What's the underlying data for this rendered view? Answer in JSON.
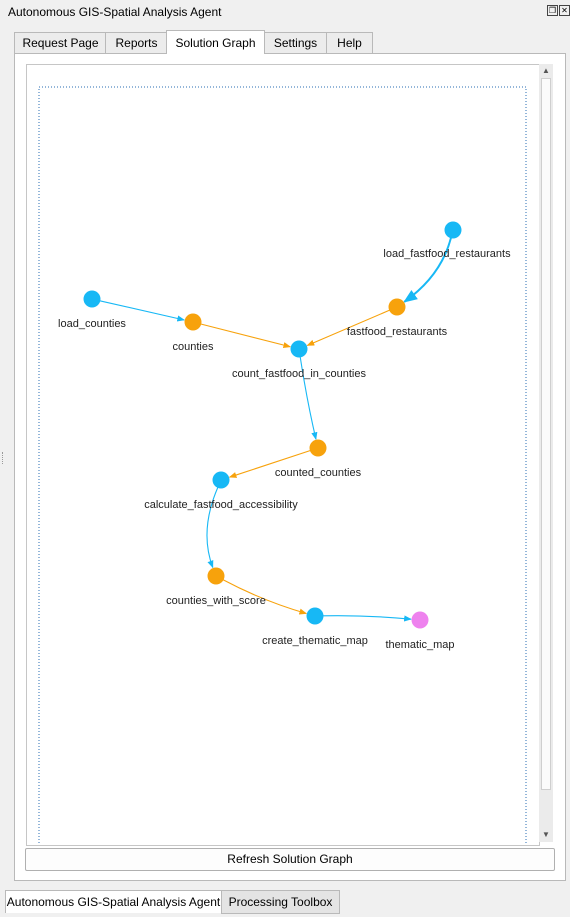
{
  "window": {
    "title": "Autonomous GIS-Spatial Analysis Agent",
    "float_icon": "float-icon",
    "close_icon": "close-icon"
  },
  "tabs": [
    {
      "label": "Request Page",
      "active": false
    },
    {
      "label": "Reports",
      "active": false
    },
    {
      "label": "Solution Graph",
      "active": true
    },
    {
      "label": "Settings",
      "active": false
    },
    {
      "label": "Help",
      "active": false
    }
  ],
  "graph": {
    "colors": {
      "operation": "#17b8f5",
      "data": "#f7a20c",
      "output": "#ee82ee",
      "edge_operation": "#17b8f5",
      "edge_data": "#f7a20c",
      "frame": "#2a6db3"
    },
    "nodes": [
      {
        "id": "load_fastfood_restaurants",
        "label": "load_fastfood_restaurants",
        "kind": "operation"
      },
      {
        "id": "fastfood_restaurants",
        "label": "fastfood_restaurants",
        "kind": "data"
      },
      {
        "id": "load_counties",
        "label": "load_counties",
        "kind": "operation"
      },
      {
        "id": "counties",
        "label": "counties",
        "kind": "data"
      },
      {
        "id": "count_fastfood_in_counties",
        "label": "count_fastfood_in_counties",
        "kind": "operation"
      },
      {
        "id": "counted_counties",
        "label": "counted_counties",
        "kind": "data"
      },
      {
        "id": "calculate_fastfood_accessibility",
        "label": "calculate_fastfood_accessibility",
        "kind": "operation"
      },
      {
        "id": "counties_with_score",
        "label": "counties_with_score",
        "kind": "data"
      },
      {
        "id": "create_thematic_map",
        "label": "create_thematic_map",
        "kind": "operation"
      },
      {
        "id": "thematic_map",
        "label": "thematic_map",
        "kind": "output"
      }
    ],
    "edges": [
      {
        "from": "load_fastfood_restaurants",
        "to": "fastfood_restaurants"
      },
      {
        "from": "load_counties",
        "to": "counties"
      },
      {
        "from": "counties",
        "to": "count_fastfood_in_counties"
      },
      {
        "from": "fastfood_restaurants",
        "to": "count_fastfood_in_counties"
      },
      {
        "from": "count_fastfood_in_counties",
        "to": "counted_counties"
      },
      {
        "from": "counted_counties",
        "to": "calculate_fastfood_accessibility"
      },
      {
        "from": "calculate_fastfood_accessibility",
        "to": "counties_with_score"
      },
      {
        "from": "counties_with_score",
        "to": "create_thematic_map"
      },
      {
        "from": "create_thematic_map",
        "to": "thematic_map"
      }
    ]
  },
  "refresh_button": "Refresh Solution Graph",
  "bottom_tabs": [
    {
      "label": "Autonomous GIS-Spatial Analysis Agent",
      "active": true
    },
    {
      "label": "Processing Toolbox",
      "active": false
    }
  ]
}
